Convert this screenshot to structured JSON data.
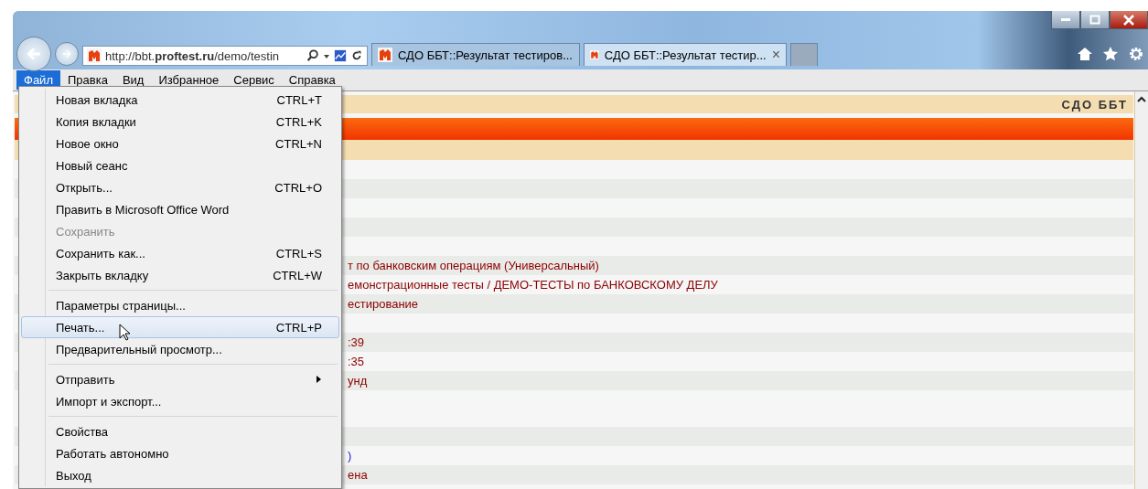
{
  "address_bar": {
    "url": "http://bbt.**proftest.ru**/demo/testin"
  },
  "tabs": [
    {
      "title": "СДО ББТ::Результат тестиров...",
      "selected": false
    },
    {
      "title": "СДО ББТ::Результат тестир...",
      "selected": true,
      "close": "×"
    }
  ],
  "menu_bar": [
    {
      "label": "Файл",
      "selected": true
    },
    {
      "label": "Правка",
      "selected": false
    },
    {
      "label": "Вид",
      "selected": false
    },
    {
      "label": "Избранное",
      "selected": false
    },
    {
      "label": "Сервис",
      "selected": false
    },
    {
      "label": "Справка",
      "selected": false
    }
  ],
  "file_menu": [
    {
      "kind": "item",
      "label": "Новая вкладка",
      "shortcut": "CTRL+T",
      "disabled": false,
      "selected": false
    },
    {
      "kind": "item",
      "label": "Копия вкладки",
      "shortcut": "CTRL+K",
      "disabled": false,
      "selected": false
    },
    {
      "kind": "item",
      "label": "Новое окно",
      "shortcut": "CTRL+N",
      "disabled": false,
      "selected": false
    },
    {
      "kind": "item",
      "label": "Новый сеанс",
      "disabled": false,
      "selected": false
    },
    {
      "kind": "item",
      "label": "Открыть...",
      "shortcut": "CTRL+O",
      "disabled": false,
      "selected": false
    },
    {
      "kind": "item",
      "label": "Править в Microsoft Office Word",
      "disabled": false,
      "selected": false
    },
    {
      "kind": "item",
      "label": "Сохранить",
      "disabled": true,
      "selected": false
    },
    {
      "kind": "item",
      "label": "Сохранить как...",
      "shortcut": "CTRL+S",
      "disabled": false,
      "selected": false
    },
    {
      "kind": "item",
      "label": "Закрыть вкладку",
      "shortcut": "CTRL+W",
      "disabled": false,
      "selected": false
    },
    {
      "kind": "separator"
    },
    {
      "kind": "item",
      "label": "Параметры страницы...",
      "disabled": false,
      "selected": false
    },
    {
      "kind": "item",
      "label": "Печать...",
      "shortcut": "CTRL+P",
      "disabled": false,
      "selected": true
    },
    {
      "kind": "item",
      "label": "Предварительный просмотр...",
      "disabled": false,
      "selected": false
    },
    {
      "kind": "separator"
    },
    {
      "kind": "submenu",
      "label": "Отправить",
      "disabled": false,
      "selected": false
    },
    {
      "kind": "item",
      "label": "Импорт и экспорт...",
      "disabled": false,
      "selected": false
    },
    {
      "kind": "separator"
    },
    {
      "kind": "item",
      "label": "Свойства",
      "disabled": false,
      "selected": false
    },
    {
      "kind": "item",
      "label": "Работать автономно",
      "disabled": false,
      "selected": false
    },
    {
      "kind": "item",
      "label": "Выход",
      "disabled": false,
      "selected": false
    }
  ],
  "page": {
    "header": "СДО ББТ",
    "rows": [
      {},
      {},
      {},
      {},
      {},
      {
        "text": "т по банковским операциям (Универсальный)",
        "kind": "value"
      },
      {
        "text": "емонстрационные тесты / ДЕМО-ТЕСТЫ по БАНКОВСКОМУ ДЕЛУ",
        "kind": "value"
      },
      {
        "text": "естирование",
        "kind": "value"
      },
      {},
      {
        "text": ":39",
        "kind": "value"
      },
      {
        "text": ":35",
        "kind": "value"
      },
      {
        "text": "унд",
        "kind": "value"
      },
      {
        "tall": true
      },
      {},
      {
        "text": ")",
        "kind": "link"
      },
      {
        "text": "ена",
        "kind": "value"
      }
    ]
  }
}
